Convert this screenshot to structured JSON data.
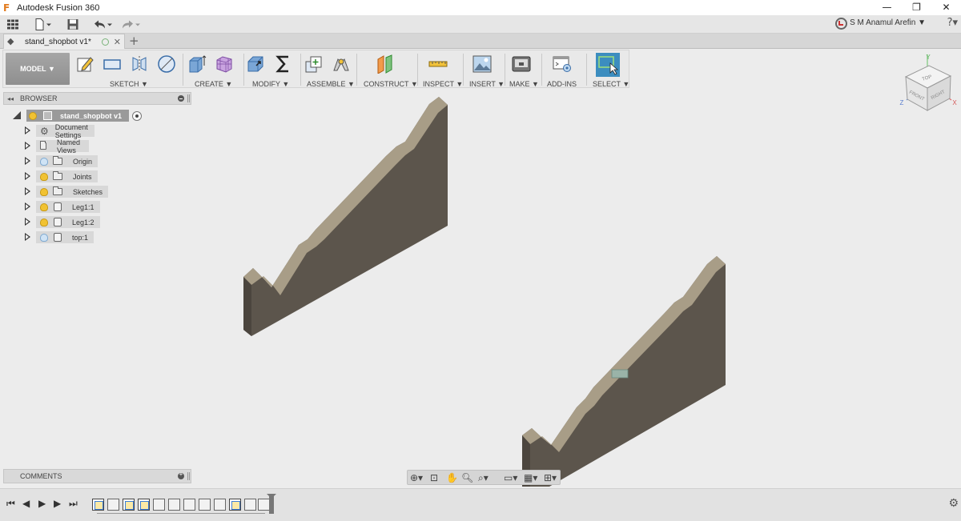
{
  "window": {
    "title": "Autodesk Fusion 360",
    "controls": {
      "minimize": "—",
      "restore": "❐",
      "close": "✕"
    }
  },
  "quick_access": {
    "user": "S M Anamul Arefin ▼",
    "help": "?▾"
  },
  "document_tab": {
    "label": "stand_shopbot v1*",
    "close": "✕",
    "new_tab": "+"
  },
  "toolbar": {
    "workspace": "MODEL ▼",
    "groups": [
      {
        "label": "SKETCH ▼"
      },
      {
        "label": "CREATE ▼"
      },
      {
        "label": "MODIFY ▼"
      },
      {
        "label": "ASSEMBLE ▼"
      },
      {
        "label": "CONSTRUCT ▼"
      },
      {
        "label": "INSPECT ▼"
      },
      {
        "label": "INSERT ▼"
      },
      {
        "label": "MAKE ▼"
      },
      {
        "label": "ADD-INS"
      },
      {
        "label": "SELECT ▼"
      }
    ]
  },
  "browser": {
    "header": "BROWSER",
    "root": "stand_shopbot v1",
    "items": [
      {
        "label": "Document Settings",
        "icon": "gear-icon"
      },
      {
        "label": "Named Views",
        "icon": "folder-icon"
      },
      {
        "label": "Origin",
        "icon": "folder-icon",
        "bulb": "off"
      },
      {
        "label": "Joints",
        "icon": "folder-icon",
        "bulb": "on"
      },
      {
        "label": "Sketches",
        "icon": "folder-icon",
        "bulb": "on"
      },
      {
        "label": "Leg1:1",
        "icon": "component-icon",
        "bulb": "on"
      },
      {
        "label": "Leg1:2",
        "icon": "component-icon",
        "bulb": "on"
      },
      {
        "label": "top:1",
        "icon": "component-icon",
        "bulb": "off"
      }
    ]
  },
  "comments": {
    "header": "COMMENTS"
  },
  "viewcube": {
    "top": "TOP",
    "front": "FRONT",
    "right": "RIGHT",
    "axis_x": "X",
    "axis_y": "Y",
    "axis_z": "Z"
  },
  "colors": {
    "accent": "#3c8dbf",
    "part_face": "#5c554c",
    "part_edge": "#a89d87",
    "viewport": "#ececec"
  }
}
